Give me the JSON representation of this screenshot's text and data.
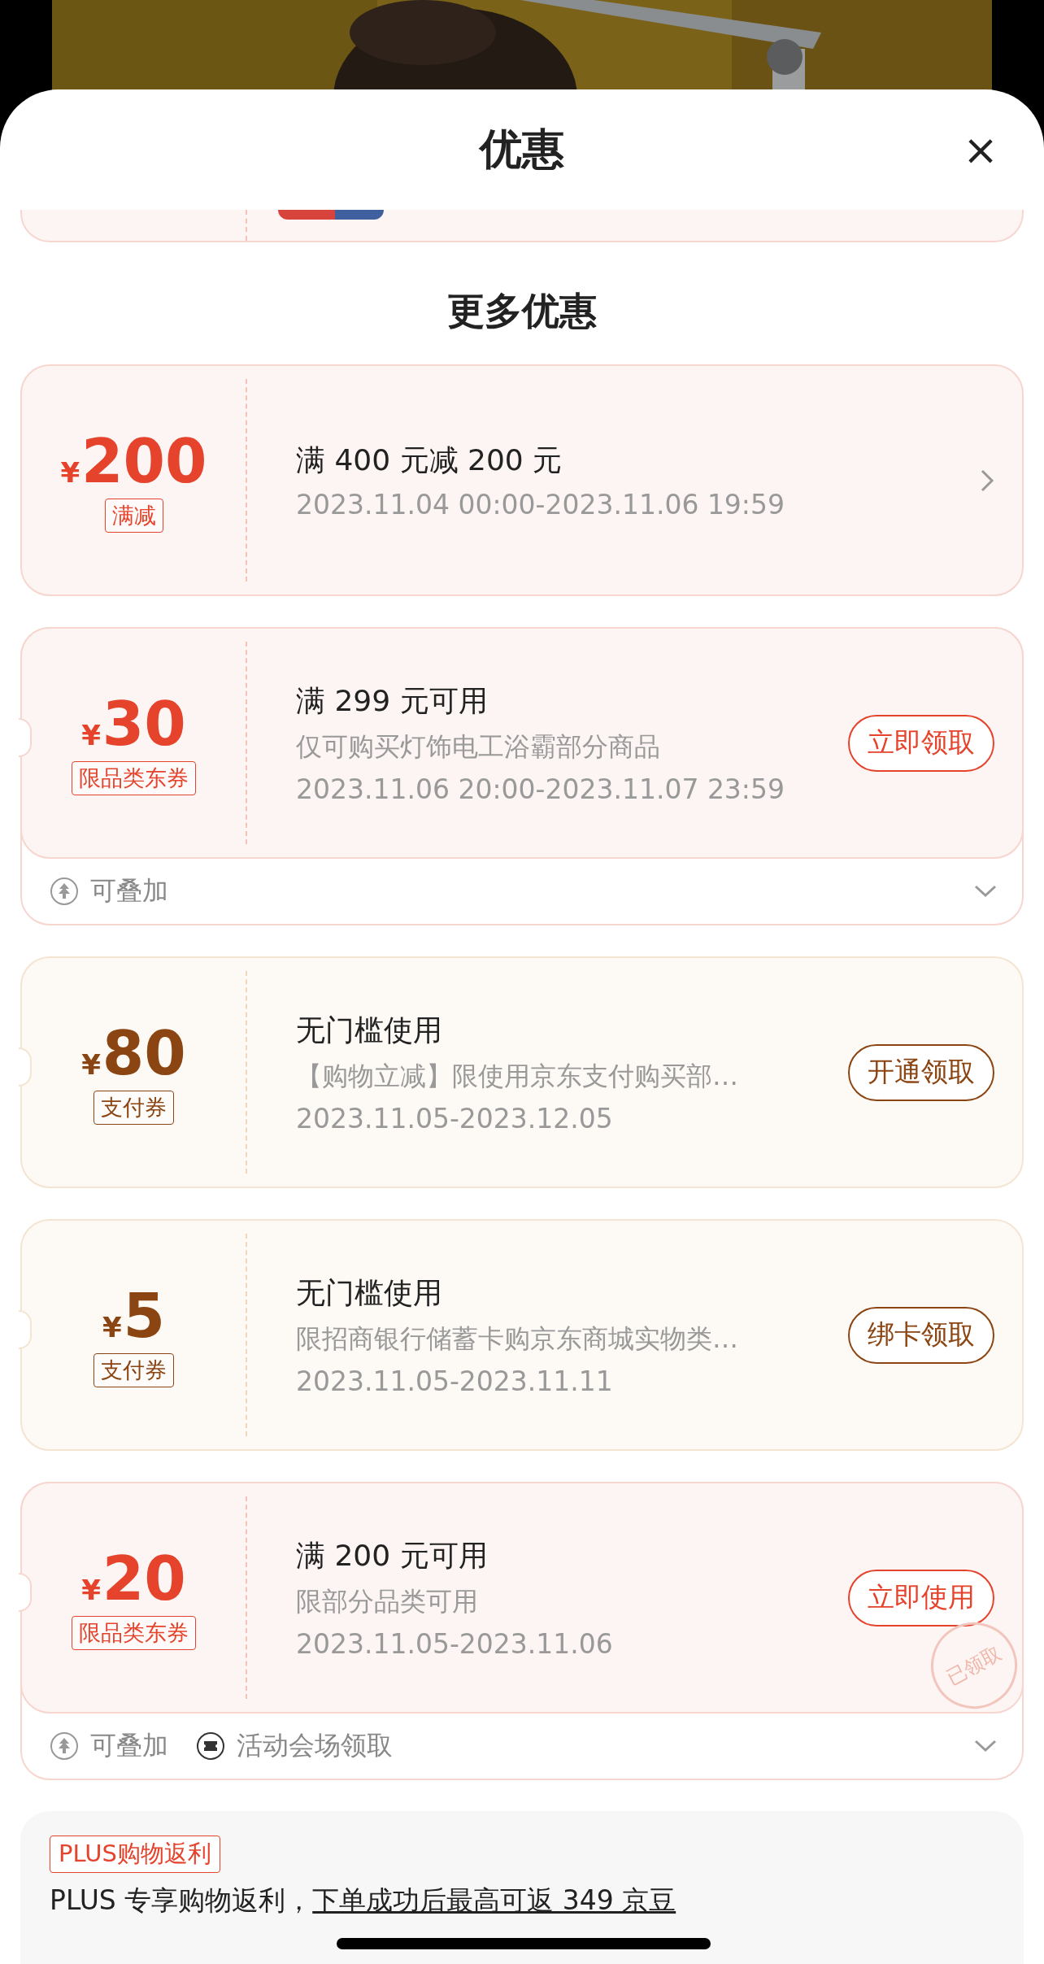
{
  "sheet": {
    "title": "优惠",
    "close": "×"
  },
  "section_title": "更多优惠",
  "coupons": [
    {
      "kind": "red",
      "amount": "200",
      "currency": "¥",
      "tag": "满减",
      "title": "满 400 元减 200 元",
      "date": "2023.11.04 00:00-2023.11.06 19:59",
      "action": {
        "kind": "chevron"
      },
      "notch": false
    },
    {
      "kind": "red",
      "amount": "30",
      "currency": "¥",
      "tag": "限品类东券",
      "title": "满 299 元可用",
      "desc": "仅可购买灯饰电工浴霸部分商品",
      "date": "2023.11.06 20:00-2023.11.07 23:59",
      "action": {
        "kind": "button",
        "label": "立即领取"
      },
      "notch": true,
      "footer": [
        {
          "kind": "stack",
          "text": "可叠加"
        }
      ]
    },
    {
      "kind": "brown",
      "amount": "80",
      "currency": "¥",
      "tag": "支付券",
      "title": "无门槛使用",
      "desc": "【购物立减】限使用京东支付购买部…",
      "date": "2023.11.05-2023.12.05",
      "action": {
        "kind": "button",
        "label": "开通领取"
      },
      "notch": true
    },
    {
      "kind": "brown",
      "amount": "5",
      "currency": "¥",
      "tag": "支付券",
      "title": "无门槛使用",
      "desc": "限招商银行储蓄卡购京东商城实物类…",
      "date": "2023.11.05-2023.11.11",
      "action": {
        "kind": "button",
        "label": "绑卡领取"
      },
      "notch": true
    },
    {
      "kind": "red",
      "amount": "20",
      "currency": "¥",
      "tag": "限品类东券",
      "title": "满 200 元可用",
      "desc": "限部分品类可用",
      "date": "2023.11.05-2023.11.06",
      "action": {
        "kind": "button",
        "label": "立即使用"
      },
      "notch": true,
      "stamp": "已领取",
      "footer": [
        {
          "kind": "stack",
          "text": "可叠加"
        },
        {
          "kind": "venue",
          "text": "活动会场领取"
        }
      ]
    }
  ],
  "plus": {
    "tag": "PLUS购物返利",
    "text": "PLUS 专享购物返利，",
    "link": "下单成功后最高可返 349 京豆"
  }
}
